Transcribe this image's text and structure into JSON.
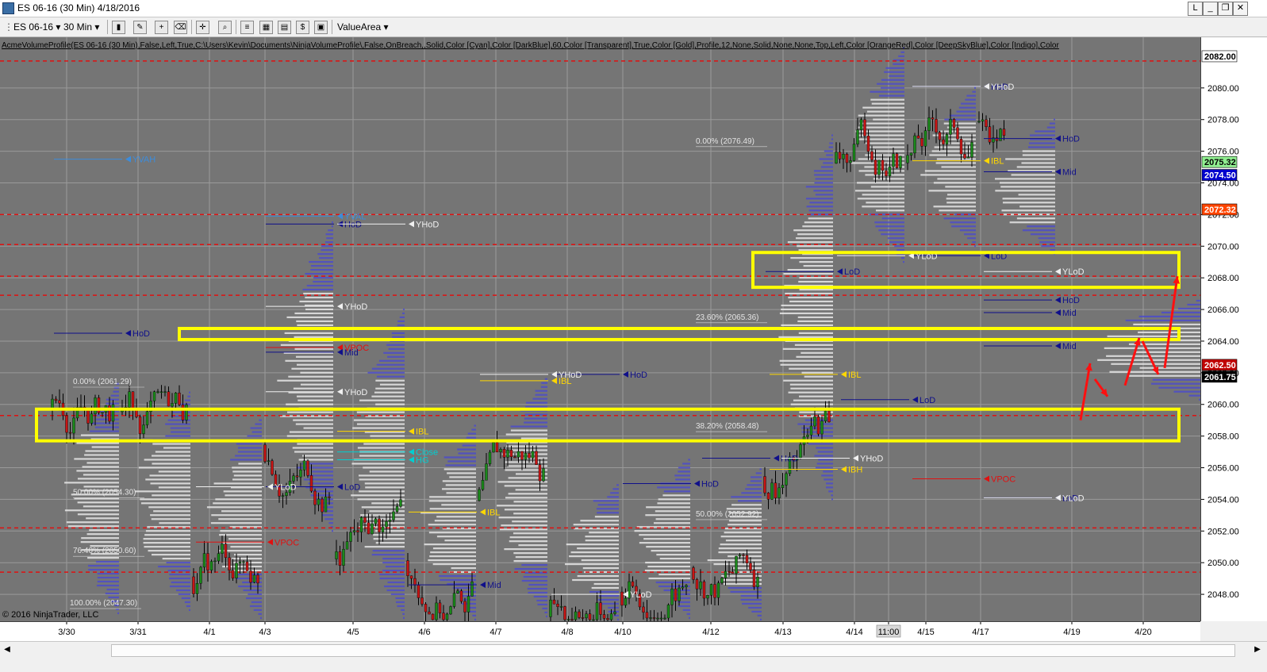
{
  "window": {
    "title": "ES 06-16 (30 Min)  4/18/2016",
    "controls": [
      "L",
      "_",
      "❐",
      "✕"
    ]
  },
  "toolbar": {
    "instrument": "ES 06-16",
    "interval": "30 Min",
    "template": "ValueArea",
    "icons": [
      "bar-type-icon",
      "draw-pencil-icon",
      "zoom-icon",
      "crosshair-icon",
      "search-icon",
      "data-box-icon",
      "chart-icon",
      "dollar-icon",
      "image-icon",
      "properties-icon"
    ]
  },
  "indicator_label": "AcmeVolumeProfile(ES 06-16 (30 Min),False,Left,True,C:\\Users\\Kevin\\Documents\\NinjaVolumeProfile\\,False,OnBreach,,Solid,Color [Cyan],Color [DarkBlue],60,Color [Transparent],True,Color [Gold],Profile,12,None,Solid,None,None,Top,Left,Color [OrangeRed],Color [DeepSkyBlue],Color [Indigo],Color",
  "copyright": "© 2016 NinjaTrader, LLC",
  "chart_data": {
    "type": "candlestick",
    "instrument": "ES 06-16",
    "interval": "30 Min",
    "ylim": [
      2046.3,
      2083.2
    ],
    "y_ticks": [
      2048.0,
      2050.0,
      2052.0,
      2054.0,
      2056.0,
      2058.0,
      2060.0,
      2062.0,
      2064.0,
      2066.0,
      2068.0,
      2070.0,
      2072.0,
      2074.0,
      2076.0,
      2078.0,
      2080.0
    ],
    "y_tick_labels": [
      "2048.00",
      "2050.00",
      "2052.00",
      "2054.00",
      "2056.00",
      "2058.00",
      "2060.00",
      "2062.00",
      "2064.00",
      "2066.00",
      "2068.00",
      "2070.00",
      "2072.00",
      "2074.00",
      "2076.00",
      "2078.00",
      "2080.00"
    ],
    "x_labels": [
      "3/30",
      "3/31",
      "4/1",
      "4/3",
      "4/5",
      "4/6",
      "4/7",
      "4/8",
      "4/10",
      "4/12",
      "4/13",
      "4/14",
      "11:00",
      "4/15",
      "4/17",
      "4/19",
      "4/20"
    ],
    "highlighted_x_label": "11:00",
    "price_markers": [
      {
        "value": 2082.0,
        "label": "2082.00",
        "color": "#ffffff",
        "text_color": "#000000"
      },
      {
        "value": 2075.32,
        "label": "2075.32",
        "color": "#90ee90",
        "text_color": "#000000"
      },
      {
        "value": 2074.5,
        "label": "2074.50",
        "color": "#0000cd",
        "text_color": "#ffffff"
      },
      {
        "value": 2072.32,
        "label": "2072.32",
        "color": "#ff4500",
        "text_color": "#ffffff"
      },
      {
        "value": 2062.5,
        "label": "2062.50",
        "color": "#c00000",
        "text_color": "#ffffff"
      },
      {
        "value": 2061.75,
        "label": "2061.75",
        "color": "#000000",
        "text_color": "#ffffff"
      }
    ],
    "red_dashed_levels": [
      2081.7,
      2072.0,
      2070.1,
      2068.1,
      2066.9,
      2059.3,
      2052.2,
      2049.4
    ],
    "yellow_boxes": [
      {
        "x_from": "4/13",
        "x_to": "4/20",
        "y_low": 2067.4,
        "y_high": 2069.6
      },
      {
        "x_from": "4/1",
        "x_to": "4/20",
        "y_low": 2064.1,
        "y_high": 2064.8
      },
      {
        "x_from": "3/30",
        "x_to": "4/20",
        "y_low": 2057.7,
        "y_high": 2059.7
      }
    ],
    "session_levels": [
      {
        "text": "HoD",
        "price": 2064.5,
        "kind": "HoD"
      },
      {
        "text": "HoD",
        "price": 2071.4,
        "kind": "HoD"
      },
      {
        "text": "YHoD",
        "price": 2071.4,
        "kind": "YHoD"
      },
      {
        "text": "YHoD",
        "price": 2066.2,
        "kind": "YHoD"
      },
      {
        "text": "VPOC",
        "price": 2063.6,
        "kind": "VPOC"
      },
      {
        "text": "Mid",
        "price": 2063.3,
        "kind": "Mid"
      },
      {
        "text": "IBL",
        "price": 2061.5,
        "kind": "IBL"
      },
      {
        "text": "HoD",
        "price": 2061.9,
        "kind": "HoD"
      },
      {
        "text": "YHoD",
        "price": 2061.9,
        "kind": "YHoD"
      },
      {
        "text": "YHoD",
        "price": 2060.8,
        "kind": "YHoD"
      },
      {
        "text": "IBL",
        "price": 2058.3,
        "kind": "IBL"
      },
      {
        "text": "Close",
        "price": 2057.0,
        "kind": "Close"
      },
      {
        "text": "HG",
        "price": 2056.5,
        "kind": "HG"
      },
      {
        "text": "LoD",
        "price": 2054.8,
        "kind": "LoD"
      },
      {
        "text": "YLoD",
        "price": 2054.8,
        "kind": "YLoD"
      },
      {
        "text": "IBL",
        "price": 2053.2,
        "kind": "IBL"
      },
      {
        "text": "VPOC",
        "price": 2051.3,
        "kind": "VPOC"
      },
      {
        "text": "Mid",
        "price": 2048.6,
        "kind": "Mid"
      },
      {
        "text": "YLoD",
        "price": 2048.0,
        "kind": "YLoD"
      },
      {
        "text": "HoD",
        "price": 2055.0,
        "kind": "HoD"
      },
      {
        "text": "HoD",
        "price": 2056.6,
        "kind": "HoD"
      },
      {
        "text": "YHoD",
        "price": 2056.6,
        "kind": "YHoD"
      },
      {
        "text": "VPOC",
        "price": 2055.3,
        "kind": "VPOC"
      },
      {
        "text": "HoD",
        "price": 2076.8,
        "kind": "HoD"
      },
      {
        "text": "HoD",
        "price": 2080.1,
        "kind": "HoD"
      },
      {
        "text": "YHoD",
        "price": 2080.1,
        "kind": "YHoD"
      },
      {
        "text": "IBL",
        "price": 2075.4,
        "kind": "IBL"
      },
      {
        "text": "Mid",
        "price": 2074.7,
        "kind": "Mid"
      },
      {
        "text": "LoD",
        "price": 2069.4,
        "kind": "LoD"
      },
      {
        "text": "YLoD",
        "price": 2069.4,
        "kind": "YLoD"
      },
      {
        "text": "LoD",
        "price": 2068.4,
        "kind": "LoD"
      },
      {
        "text": "YLoD",
        "price": 2068.4,
        "kind": "YLoD"
      },
      {
        "text": "Mid",
        "price": 2065.8,
        "kind": "Mid"
      },
      {
        "text": "HoD",
        "price": 2066.6,
        "kind": "HoD"
      },
      {
        "text": "Mid",
        "price": 2063.7,
        "kind": "Mid"
      },
      {
        "text": "IBL",
        "price": 2061.9,
        "kind": "IBL"
      },
      {
        "text": "LoD",
        "price": 2060.3,
        "kind": "LoD"
      },
      {
        "text": "IBH",
        "price": 2055.9,
        "kind": "IBH"
      },
      {
        "text": "LoD",
        "price": 2054.1,
        "kind": "LoD"
      },
      {
        "text": "YLoD",
        "price": 2054.1,
        "kind": "YLoD"
      },
      {
        "text": "YVAH",
        "price": 2075.5,
        "kind": "VA"
      },
      {
        "text": "YVAL",
        "price": 2071.9,
        "kind": "VA"
      }
    ],
    "fib_levels": [
      {
        "text": "0.00% (2076.49)",
        "price": 2076.49
      },
      {
        "text": "23.60% (2065.36)",
        "price": 2065.36
      },
      {
        "text": "38.20% (2058.48)",
        "price": 2058.48
      },
      {
        "text": "50.00% (2052.92)",
        "price": 2052.92
      },
      {
        "text": "0.00% (2061.29)",
        "price": 2061.29
      },
      {
        "text": "50.00% (2054.30)",
        "price": 2054.3
      },
      {
        "text": "76.40% (2050.60)",
        "price": 2050.6
      },
      {
        "text": "100.00% (2047.30)",
        "price": 2047.3
      }
    ],
    "grid": true,
    "background": "#757575"
  }
}
